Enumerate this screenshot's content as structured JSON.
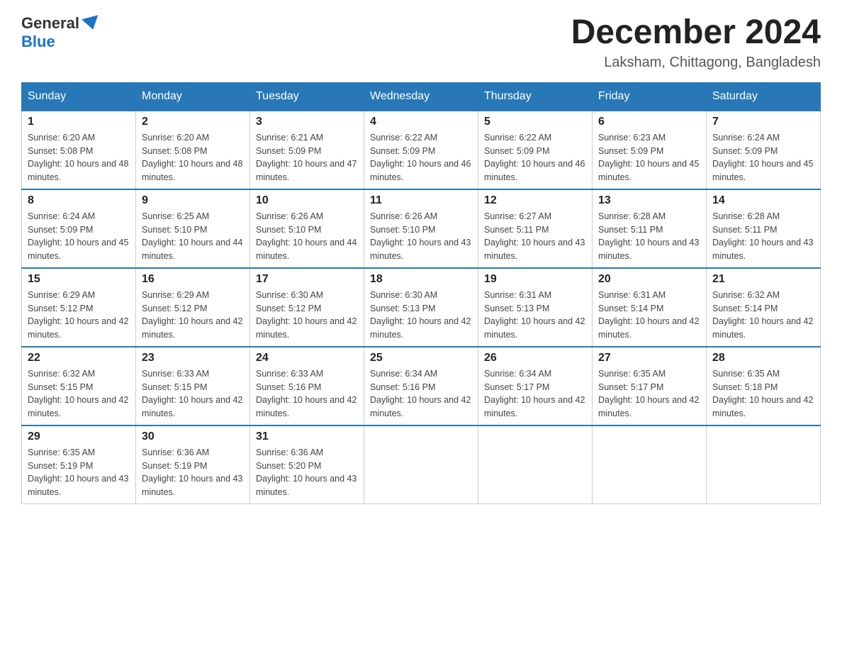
{
  "header": {
    "logo_general": "General",
    "logo_blue": "Blue",
    "month_title": "December 2024",
    "subtitle": "Laksham, Chittagong, Bangladesh"
  },
  "days_of_week": [
    "Sunday",
    "Monday",
    "Tuesday",
    "Wednesday",
    "Thursday",
    "Friday",
    "Saturday"
  ],
  "weeks": [
    [
      {
        "num": "1",
        "sunrise": "6:20 AM",
        "sunset": "5:08 PM",
        "daylight": "10 hours and 48 minutes."
      },
      {
        "num": "2",
        "sunrise": "6:20 AM",
        "sunset": "5:08 PM",
        "daylight": "10 hours and 48 minutes."
      },
      {
        "num": "3",
        "sunrise": "6:21 AM",
        "sunset": "5:09 PM",
        "daylight": "10 hours and 47 minutes."
      },
      {
        "num": "4",
        "sunrise": "6:22 AM",
        "sunset": "5:09 PM",
        "daylight": "10 hours and 46 minutes."
      },
      {
        "num": "5",
        "sunrise": "6:22 AM",
        "sunset": "5:09 PM",
        "daylight": "10 hours and 46 minutes."
      },
      {
        "num": "6",
        "sunrise": "6:23 AM",
        "sunset": "5:09 PM",
        "daylight": "10 hours and 45 minutes."
      },
      {
        "num": "7",
        "sunrise": "6:24 AM",
        "sunset": "5:09 PM",
        "daylight": "10 hours and 45 minutes."
      }
    ],
    [
      {
        "num": "8",
        "sunrise": "6:24 AM",
        "sunset": "5:09 PM",
        "daylight": "10 hours and 45 minutes."
      },
      {
        "num": "9",
        "sunrise": "6:25 AM",
        "sunset": "5:10 PM",
        "daylight": "10 hours and 44 minutes."
      },
      {
        "num": "10",
        "sunrise": "6:26 AM",
        "sunset": "5:10 PM",
        "daylight": "10 hours and 44 minutes."
      },
      {
        "num": "11",
        "sunrise": "6:26 AM",
        "sunset": "5:10 PM",
        "daylight": "10 hours and 43 minutes."
      },
      {
        "num": "12",
        "sunrise": "6:27 AM",
        "sunset": "5:11 PM",
        "daylight": "10 hours and 43 minutes."
      },
      {
        "num": "13",
        "sunrise": "6:28 AM",
        "sunset": "5:11 PM",
        "daylight": "10 hours and 43 minutes."
      },
      {
        "num": "14",
        "sunrise": "6:28 AM",
        "sunset": "5:11 PM",
        "daylight": "10 hours and 43 minutes."
      }
    ],
    [
      {
        "num": "15",
        "sunrise": "6:29 AM",
        "sunset": "5:12 PM",
        "daylight": "10 hours and 42 minutes."
      },
      {
        "num": "16",
        "sunrise": "6:29 AM",
        "sunset": "5:12 PM",
        "daylight": "10 hours and 42 minutes."
      },
      {
        "num": "17",
        "sunrise": "6:30 AM",
        "sunset": "5:12 PM",
        "daylight": "10 hours and 42 minutes."
      },
      {
        "num": "18",
        "sunrise": "6:30 AM",
        "sunset": "5:13 PM",
        "daylight": "10 hours and 42 minutes."
      },
      {
        "num": "19",
        "sunrise": "6:31 AM",
        "sunset": "5:13 PM",
        "daylight": "10 hours and 42 minutes."
      },
      {
        "num": "20",
        "sunrise": "6:31 AM",
        "sunset": "5:14 PM",
        "daylight": "10 hours and 42 minutes."
      },
      {
        "num": "21",
        "sunrise": "6:32 AM",
        "sunset": "5:14 PM",
        "daylight": "10 hours and 42 minutes."
      }
    ],
    [
      {
        "num": "22",
        "sunrise": "6:32 AM",
        "sunset": "5:15 PM",
        "daylight": "10 hours and 42 minutes."
      },
      {
        "num": "23",
        "sunrise": "6:33 AM",
        "sunset": "5:15 PM",
        "daylight": "10 hours and 42 minutes."
      },
      {
        "num": "24",
        "sunrise": "6:33 AM",
        "sunset": "5:16 PM",
        "daylight": "10 hours and 42 minutes."
      },
      {
        "num": "25",
        "sunrise": "6:34 AM",
        "sunset": "5:16 PM",
        "daylight": "10 hours and 42 minutes."
      },
      {
        "num": "26",
        "sunrise": "6:34 AM",
        "sunset": "5:17 PM",
        "daylight": "10 hours and 42 minutes."
      },
      {
        "num": "27",
        "sunrise": "6:35 AM",
        "sunset": "5:17 PM",
        "daylight": "10 hours and 42 minutes."
      },
      {
        "num": "28",
        "sunrise": "6:35 AM",
        "sunset": "5:18 PM",
        "daylight": "10 hours and 42 minutes."
      }
    ],
    [
      {
        "num": "29",
        "sunrise": "6:35 AM",
        "sunset": "5:19 PM",
        "daylight": "10 hours and 43 minutes."
      },
      {
        "num": "30",
        "sunrise": "6:36 AM",
        "sunset": "5:19 PM",
        "daylight": "10 hours and 43 minutes."
      },
      {
        "num": "31",
        "sunrise": "6:36 AM",
        "sunset": "5:20 PM",
        "daylight": "10 hours and 43 minutes."
      },
      null,
      null,
      null,
      null
    ]
  ]
}
